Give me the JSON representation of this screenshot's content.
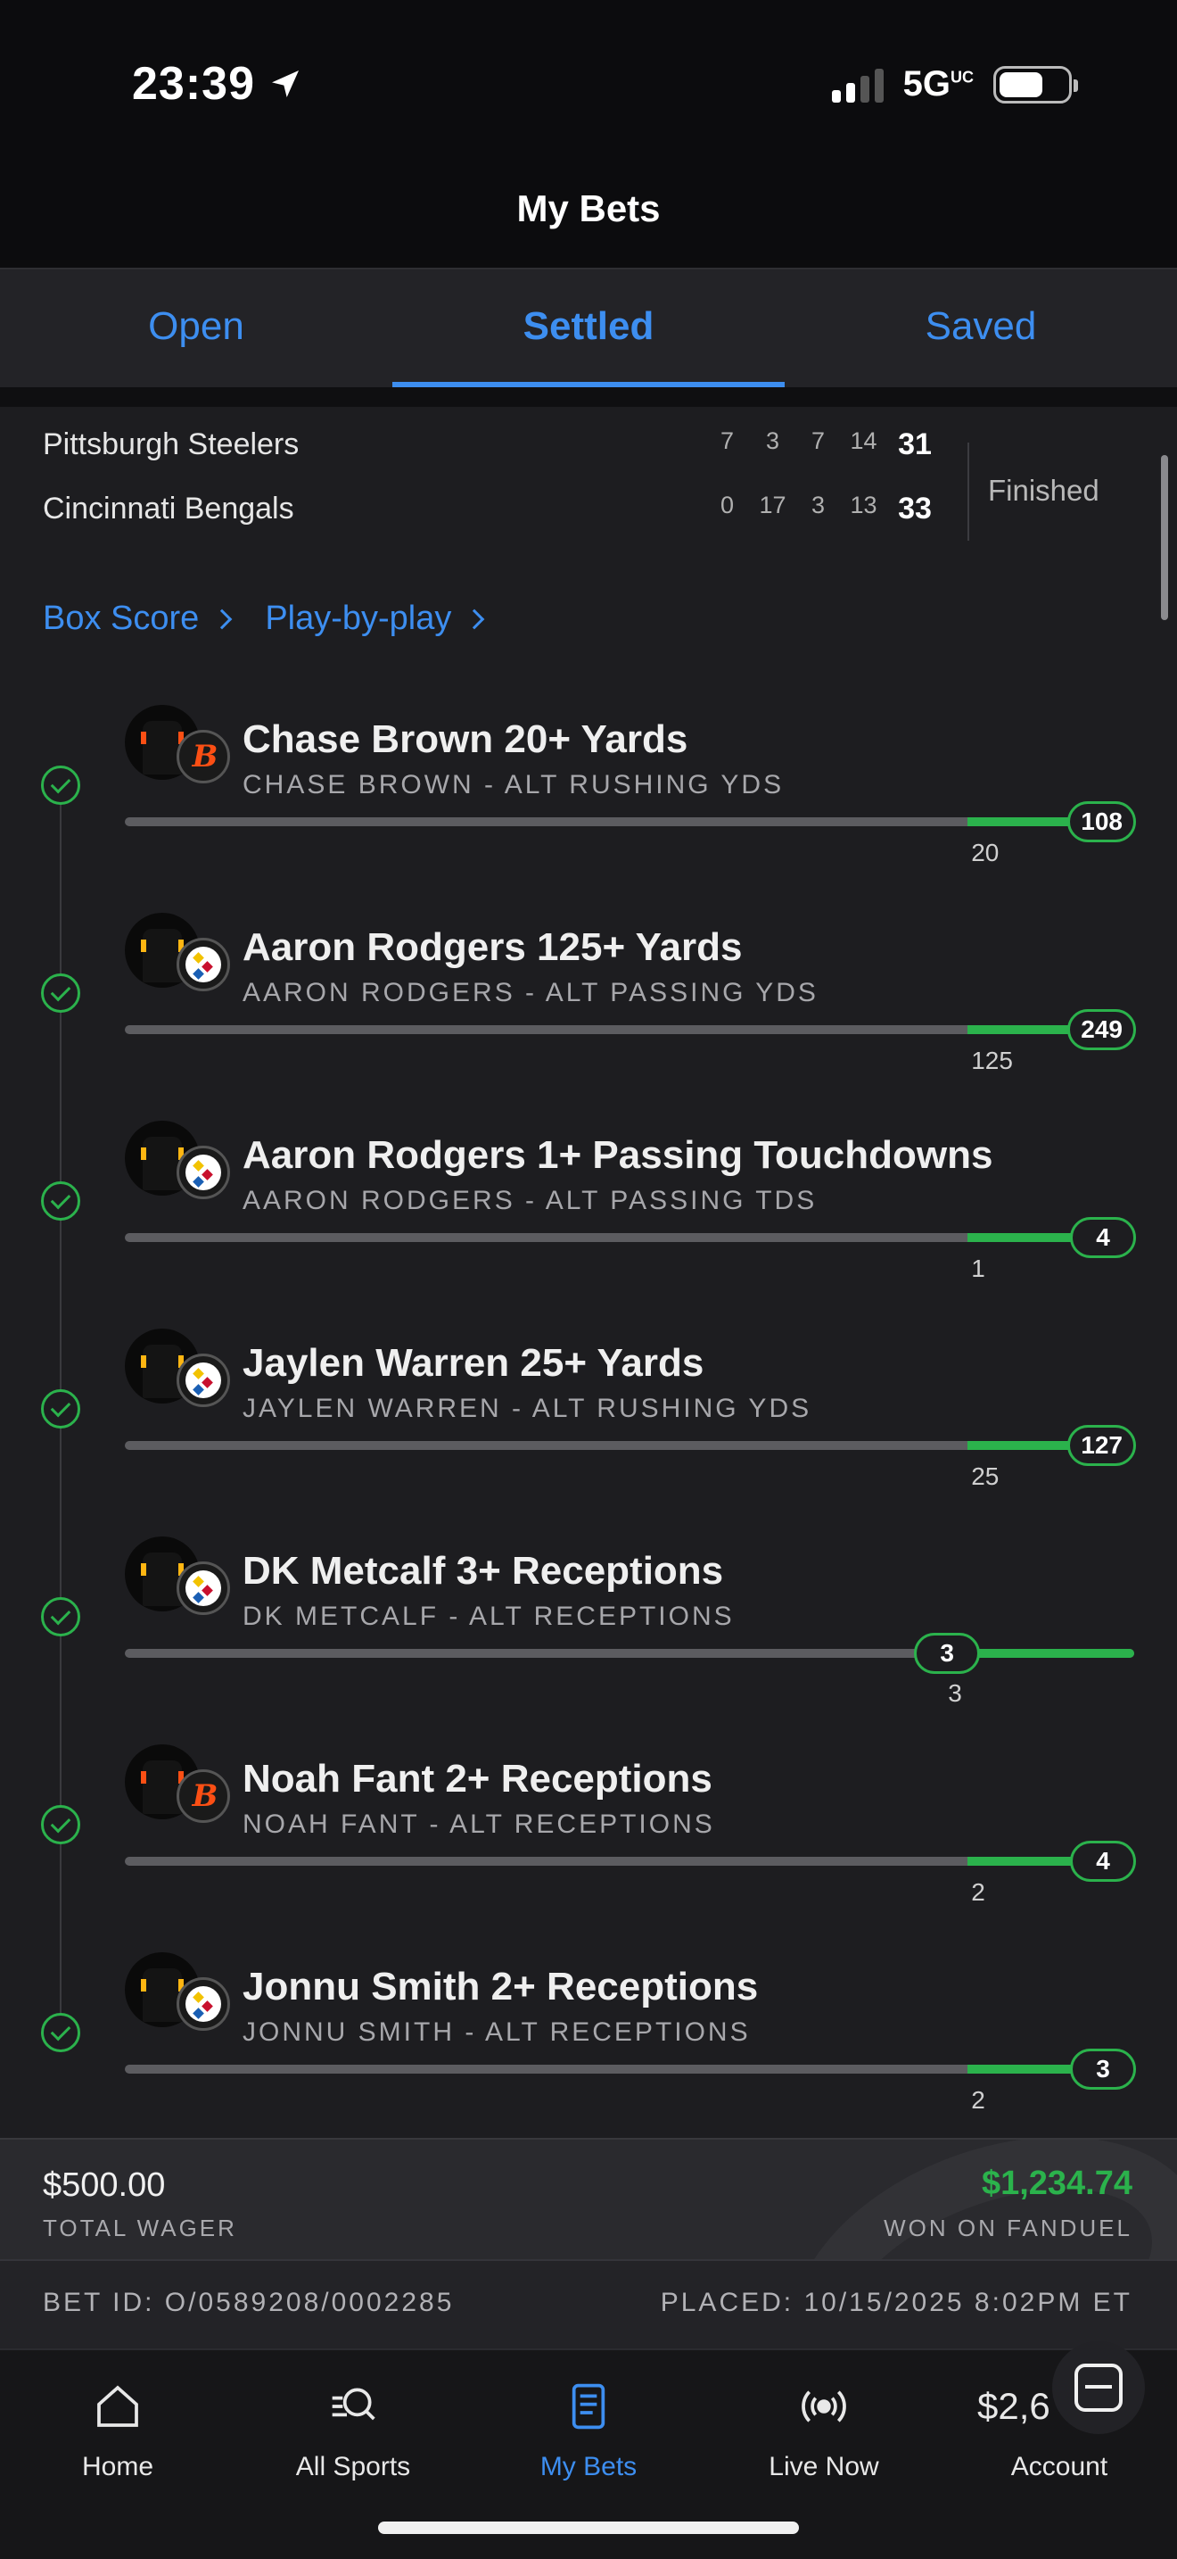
{
  "status_bar": {
    "time": "23:39",
    "network": "5G",
    "network_sup": "UC"
  },
  "header": {
    "title": "My Bets"
  },
  "tabs": [
    {
      "label": "Open",
      "active": false
    },
    {
      "label": "Settled",
      "active": true
    },
    {
      "label": "Saved",
      "active": false
    }
  ],
  "scoreboard": {
    "teams": [
      {
        "name": "Pittsburgh Steelers",
        "quarters": [
          "7",
          "3",
          "7",
          "14"
        ],
        "total": "31"
      },
      {
        "name": "Cincinnati Bengals",
        "quarters": [
          "0",
          "17",
          "3",
          "13"
        ],
        "total": "33"
      }
    ],
    "status": "Finished"
  },
  "links": {
    "box_score": "Box Score",
    "play_by_play": "Play-by-play"
  },
  "legs": [
    {
      "title": "Chase Brown 20+ Yards",
      "subtitle": "CHASE BROWN - ALT RUSHING YDS",
      "team": "CIN",
      "line": "20",
      "result": "108",
      "progress": 1.0
    },
    {
      "title": "Aaron Rodgers 125+ Yards",
      "subtitle": "AARON RODGERS - ALT PASSING YDS",
      "team": "PIT",
      "line": "125",
      "result": "249",
      "progress": 1.0
    },
    {
      "title": "Aaron Rodgers 1+ Passing Touchdowns",
      "subtitle": "AARON RODGERS - ALT PASSING TDS",
      "team": "PIT",
      "line": "1",
      "result": "4",
      "progress": 1.0
    },
    {
      "title": "Jaylen Warren 25+ Yards",
      "subtitle": "JAYLEN WARREN - ALT RUSHING YDS",
      "team": "PIT",
      "line": "25",
      "result": "127",
      "progress": 1.0
    },
    {
      "title": "DK Metcalf 3+ Receptions",
      "subtitle": "DK METCALF - ALT RECEPTIONS",
      "team": "PIT",
      "line": "3",
      "result": "3",
      "progress": 0.0
    },
    {
      "title": "Noah Fant 2+ Receptions",
      "subtitle": "NOAH FANT - ALT RECEPTIONS",
      "team": "CIN",
      "line": "2",
      "result": "4",
      "progress": 1.0
    },
    {
      "title": "Jonnu Smith 2+ Receptions",
      "subtitle": "JONNU SMITH - ALT RECEPTIONS",
      "team": "PIT",
      "line": "2",
      "result": "3",
      "progress": 1.0
    }
  ],
  "summary": {
    "wager": "$500.00",
    "wager_label": "TOTAL WAGER",
    "won": "$1,234.74",
    "won_label": "WON ON FANDUEL",
    "bet_id": "BET ID: O/0589208/0002285",
    "placed": "PLACED: 10/15/2025 8:02PM ET"
  },
  "nav": [
    {
      "label": "Home",
      "icon": "home-icon",
      "active": false
    },
    {
      "label": "All Sports",
      "icon": "search-sports-icon",
      "active": false
    },
    {
      "label": "My Bets",
      "icon": "bets-slip-icon",
      "active": true
    },
    {
      "label": "Live Now",
      "icon": "live-broadcast-icon",
      "active": false
    },
    {
      "label": "Account",
      "icon": "account-balance-icon",
      "active": false,
      "balance": "$2,6"
    }
  ],
  "colors": {
    "accent": "#3d8ef0",
    "success": "#2bb24c",
    "background": "#1d1d20"
  }
}
